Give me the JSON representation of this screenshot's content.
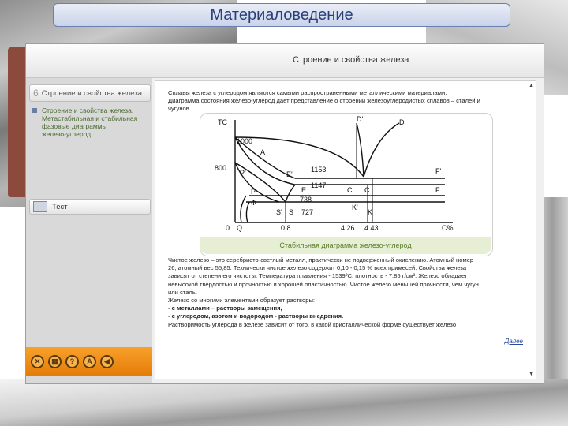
{
  "slide_title": "Материаловедение",
  "header": {
    "title": "Строение и свойства железа"
  },
  "sidebar": {
    "section": {
      "number": "6",
      "label": "Строение и свойства железа"
    },
    "subitem_lines": [
      "Строение и свойства железа.",
      "Метастабильная и стабильная",
      "фазовые диаграммы",
      "железо-углерод"
    ],
    "test_label": "Тест"
  },
  "toolbar": {
    "buttons": [
      "close-icon",
      "print-icon",
      "help-icon",
      "author-icon",
      "back-icon"
    ]
  },
  "content": {
    "intro_lines": [
      "Сплавы железа с углеродом являются самыми распространенными металлическими материалами.",
      "Диаграмма состояния железо-углерод дает представление о строении железоуглеродистых сплавов – сталей и",
      "чугунов."
    ],
    "diagram": {
      "caption": "Стабильная диаграмма железо-углерод",
      "labels": {
        "tc": "TC",
        "t1000": "1000",
        "t800": "800",
        "zero": "0",
        "A": "A",
        "P_prime": "P'",
        "P": "P",
        "F": "Ф",
        "Q": "Q",
        "E_prime": "E'",
        "E": "E",
        "t1153": "1153",
        "t1147": "1147",
        "t738": "738",
        "t727": "727",
        "S_prime": "S'",
        "S": "S",
        "D_prime": "D'",
        "D": "D",
        "C_prime": "C'",
        "C": "C",
        "F_top_prime": "F'",
        "F_top": "F",
        "K_prime": "K'",
        "K": "K",
        "x08": "0,8",
        "x426": "4.26",
        "x443": "4.43",
        "xc": "C%"
      }
    },
    "body_lines": [
      "Чистое железо – это серебристо-светлый металл, практически не подверженный окислению. Атомный номер",
      "26, атомный вес 55,85. Технически чистое железо содержит 0,10 - 0,15 % всех примесей. Свойства железа",
      "зависят от степени его чистоты. Температура плавления - 1539ºС, плотность - 7,85 г/см³. Железо обладает",
      "невысокой твердостью и прочностью и хорошей пластичностью. Чистое железо меньшей прочности, чем чугун",
      "или сталь.",
      "Железо со многими элементами образует растворы:",
      " - с металлами – растворы замещения,",
      " - с углеродом, азотом и водородом - растворы внедрения.",
      "Растворимость углерода в железе зависит от того, в какой кристаллической форме существует железо"
    ],
    "next_link": "Далее"
  },
  "colors": {
    "toolbar": "#f08e17",
    "title_text": "#2a3f7a",
    "caption_bg": "#e6efd4"
  }
}
